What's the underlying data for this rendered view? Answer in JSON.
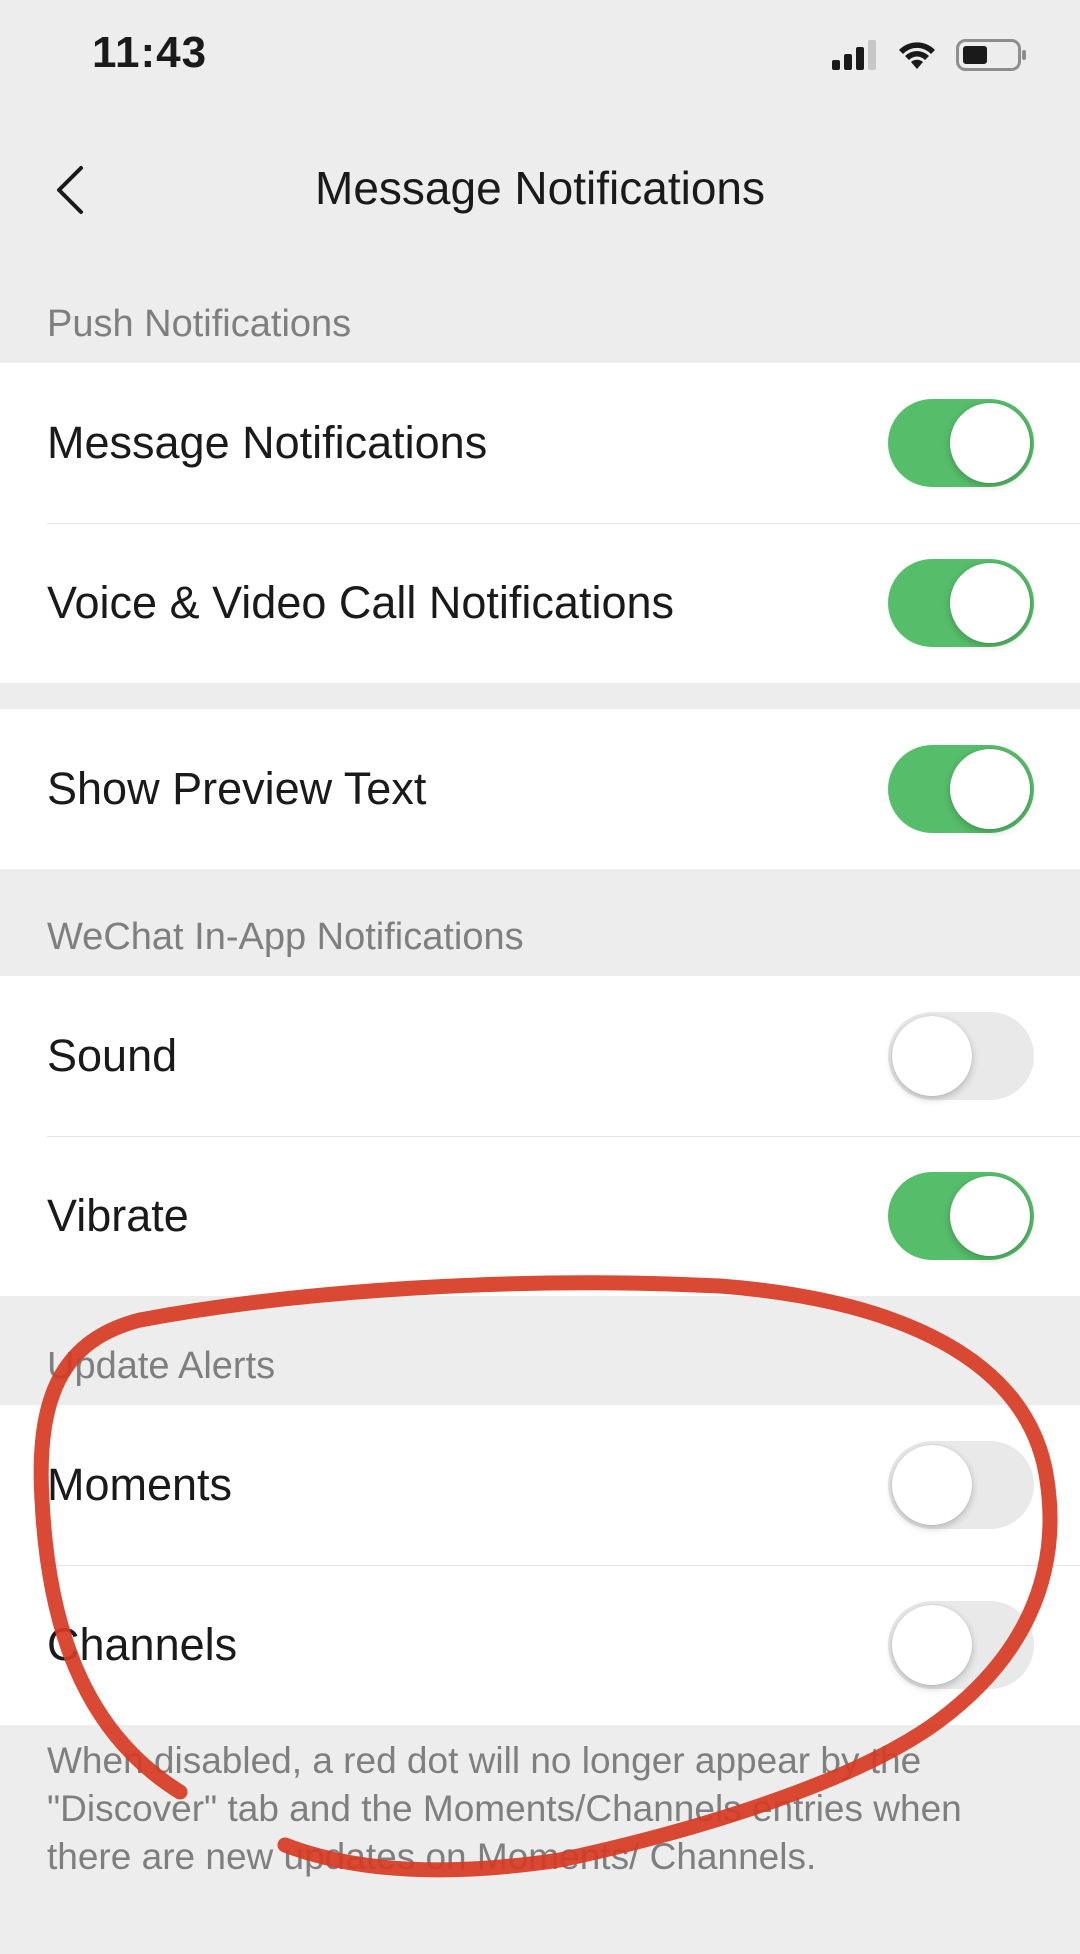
{
  "status_bar": {
    "time": "11:43"
  },
  "nav": {
    "title": "Message Notifications"
  },
  "sections": {
    "push": {
      "header": "Push Notifications",
      "items": [
        {
          "label": "Message Notifications",
          "enabled": true
        },
        {
          "label": "Voice & Video Call Notifications",
          "enabled": true
        }
      ]
    },
    "preview": {
      "items": [
        {
          "label": "Show Preview Text",
          "enabled": true
        }
      ]
    },
    "in_app": {
      "header": "WeChat In-App Notifications",
      "items": [
        {
          "label": "Sound",
          "enabled": false
        },
        {
          "label": "Vibrate",
          "enabled": true
        }
      ]
    },
    "update_alerts": {
      "header": "Update Alerts",
      "items": [
        {
          "label": "Moments",
          "enabled": false
        },
        {
          "label": "Channels",
          "enabled": false
        }
      ],
      "footnote": "When disabled, a red dot will no longer appear by the \"Discover\" tab and the Moments/Channels entries when there are new updates on Moments/ Channels."
    }
  },
  "colors": {
    "switch_on": "#56bd6a",
    "switch_off": "#e9e9ea",
    "background": "#ededed",
    "annotation": "#d63a22"
  },
  "icons": [
    "signal-icon",
    "wifi-icon",
    "battery-icon",
    "back-chevron-icon"
  ]
}
